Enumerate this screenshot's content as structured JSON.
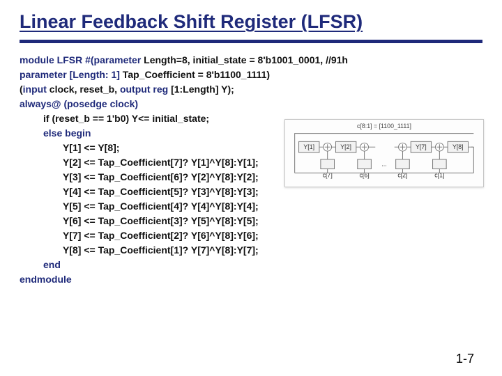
{
  "title": "Linear Feedback Shift Register (LFSR)",
  "code": {
    "l1_a": "module LFSR #(parameter",
    "l1_b": "  Length=8,",
    "l1_c": " initial_state = 8'b1001_0001, //91h",
    "l2_a": "parameter [Length: 1]",
    "l2_b": "    Tap_Coefficient = 8'b1100_1111)",
    "l3_a": "(",
    "l3_b": "input",
    "l3_c": "   clock, reset_b, ",
    "l3_d": "output reg ",
    "l3_e": "[1:Length] Y);",
    "l4_a": "always@ (posedge clock)",
    "l5_a": "if (reset_b == 1'b0) Y<= initial_state;",
    "l6_a": "else begin",
    "l7": "Y[1] <= Y[8];",
    "l8": "Y[2] <= Tap_Coefficient[7]? Y[1]^Y[8]:Y[1];",
    "l9": "Y[3] <= Tap_Coefficient[6]? Y[2]^Y[8]:Y[2];",
    "l10": "Y[4] <= Tap_Coefficient[5]? Y[3]^Y[8]:Y[3];",
    "l11": "Y[5] <= Tap_Coefficient[4]? Y[4]^Y[8]:Y[4];",
    "l12": "Y[6] <= Tap_Coefficient[3]? Y[5]^Y[8]:Y[5];",
    "l13": "Y[7] <= Tap_Coefficient[2]? Y[6]^Y[8]:Y[6];",
    "l14": "Y[8] <= Tap_Coefficient[1]? Y[7]^Y[8]:Y[7];",
    "l15": "end",
    "l16": "endmodule"
  },
  "diagram": {
    "caption": "c[8:1] = [1100_1111]",
    "regs": [
      "Y[1]",
      "Y[2]",
      "",
      "Y[7]",
      "Y[8]"
    ],
    "taps": [
      "c[7]",
      "c[6]",
      "...",
      "c[2]",
      "c[1]"
    ]
  },
  "page": "1-7"
}
